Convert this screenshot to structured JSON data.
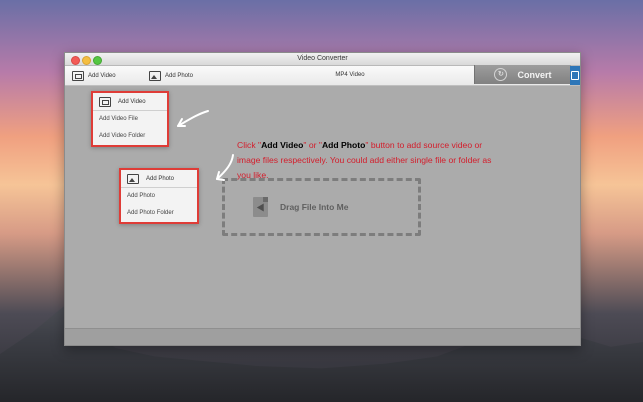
{
  "window": {
    "title": "Video Converter"
  },
  "toolbar": {
    "add_video_label": "Add Video",
    "add_photo_label": "Add Photo",
    "format_label": "MP4 Video",
    "convert_label": "Convert"
  },
  "video_menu": {
    "header": "Add Video",
    "items": [
      "Add Video File",
      "Add Video Folder"
    ]
  },
  "photo_menu": {
    "header": "Add Photo",
    "items": [
      "Add Photo",
      "Add Photo Folder"
    ]
  },
  "callout": {
    "prefix": "Click \"",
    "video_bold": "Add Video",
    "middle": "\" or \"",
    "photo_bold": "Add Photo",
    "suffix": "\" button to add source video or image files respectively. You could add either single file or folder as you like."
  },
  "dropzone": {
    "label": "Drag File Into Me"
  },
  "colors": {
    "accent_red": "#df3c37",
    "callout_red": "#d31d2b",
    "list_blue": "#2d76b8"
  },
  "icons": {
    "add_video": "film-icon",
    "add_photo": "image-icon",
    "convert": "refresh-icon",
    "list": "list-icon",
    "file": "file-drag-icon"
  }
}
